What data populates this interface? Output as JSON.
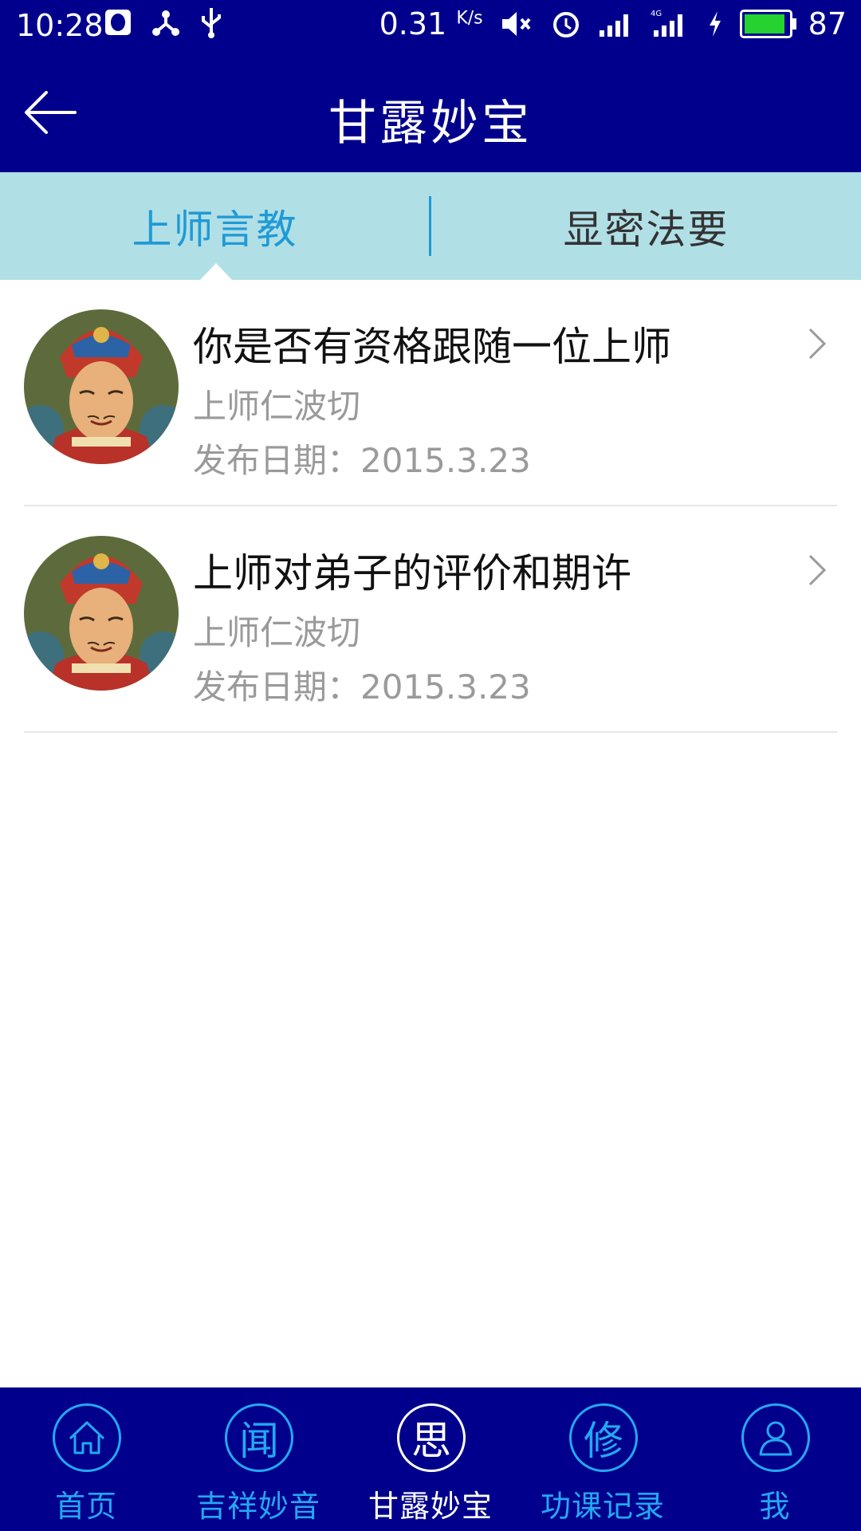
{
  "status_bar": {
    "time": "10:28",
    "net_speed": "0.31",
    "net_unit": "K/s",
    "battery": "87",
    "battery_color": "#25d22f"
  },
  "app_bar": {
    "title": "甘露妙宝"
  },
  "tabs": [
    {
      "label": "上师言教",
      "active": true
    },
    {
      "label": "显密法要",
      "active": false
    }
  ],
  "articles": [
    {
      "title": "你是否有资格跟随一位上师",
      "author": "上师仁波切",
      "date": "发布日期：2015.3.23"
    },
    {
      "title": "上师对弟子的评价和期许",
      "author": "上师仁波切",
      "date": "发布日期：2015.3.23"
    }
  ],
  "bottom_nav": [
    {
      "glyph": "",
      "label": "首页",
      "icon": "home-icon",
      "active": false
    },
    {
      "glyph": "闻",
      "label": "吉祥妙音",
      "icon": "wen-icon",
      "active": false
    },
    {
      "glyph": "思",
      "label": "甘露妙宝",
      "icon": "si-icon",
      "active": true
    },
    {
      "glyph": "修",
      "label": "功课记录",
      "icon": "xiu-icon",
      "active": false
    },
    {
      "glyph": "",
      "label": "我",
      "icon": "profile-icon",
      "active": false
    }
  ],
  "colors": {
    "primary": "#01008c",
    "tab_bg": "#b1dfe6",
    "accent": "#23a8f2",
    "active_tab_text": "#1f9ad6"
  }
}
